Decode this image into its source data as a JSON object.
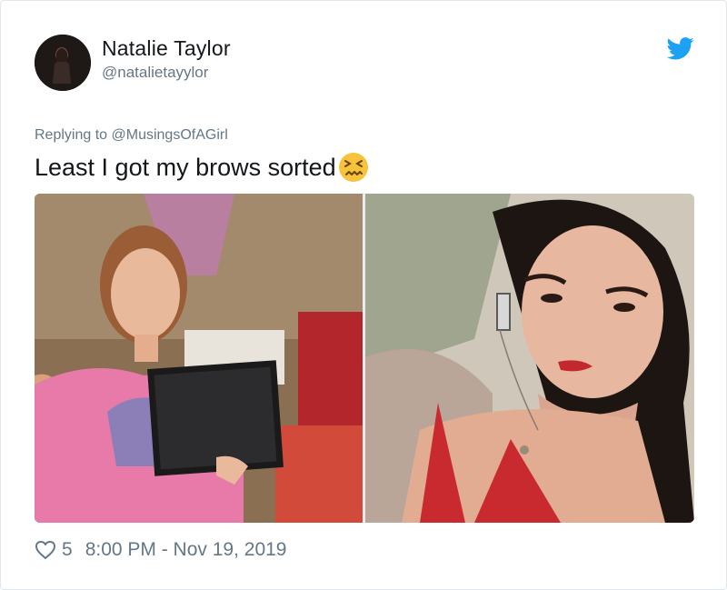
{
  "author": {
    "name": "Natalie Taylor",
    "handle": "@natalietayylor"
  },
  "reply": {
    "prefix": "Replying to ",
    "mention": "@MusingsOfAGirl"
  },
  "tweet": {
    "text": "Least I got my brows sorted",
    "emoji": "confounded-face-emoji"
  },
  "footer": {
    "likes": "5",
    "timestamp": "8:00 PM - Nov 19, 2019"
  },
  "colors": {
    "text": "#14171a",
    "secondary": "#657786",
    "twitter_blue": "#1da1f2",
    "emoji_yellow": "#f7c23c"
  },
  "icons": [
    "twitter-bird-icon",
    "heart-icon"
  ]
}
